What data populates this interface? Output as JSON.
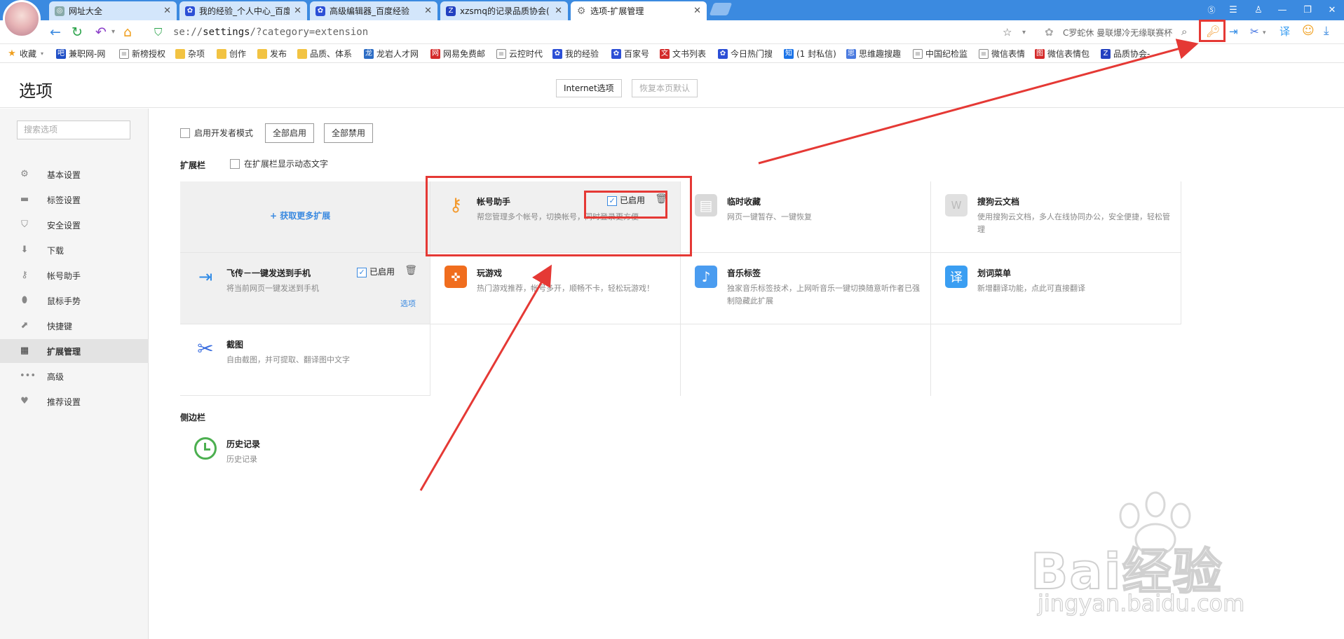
{
  "tabs": [
    {
      "label": "网址大全",
      "active": false,
      "icon": "globe-icon"
    },
    {
      "label": "我的经验_个人中心_百度",
      "active": false,
      "icon": "baidu-paw-icon"
    },
    {
      "label": "高级编辑器_百度经验",
      "active": false,
      "icon": "baidu-paw-icon"
    },
    {
      "label": "xzsmq的记录品质协会(",
      "active": false,
      "icon": "baidu-z-icon"
    },
    {
      "label": "选项-扩展管理",
      "active": true,
      "icon": "gear-icon"
    }
  ],
  "address": {
    "prefix": "se://",
    "bold": "settings",
    "suffix": "/?category=extension"
  },
  "search_box": "C罗蛇休 曼联爆冷无缘联赛杯",
  "bookmarks": [
    "收藏",
    "兼职网-网",
    "新榜授权",
    "杂项",
    "创作",
    "发布",
    "品质、体系",
    "龙岩人才网",
    "网易免费邮",
    "云控时代",
    "我的经验",
    "百家号",
    "文书列表",
    "今日热门搜",
    "(1 封私信)",
    "思维趣搜趣",
    "中国纪检监",
    "微信表情",
    "微信表情包",
    "品质协会-"
  ],
  "page": {
    "title": "选项",
    "internet_options": "Internet选项",
    "restore_defaults": "恢复本页默认"
  },
  "sidebar": {
    "search_placeholder": "搜索选项",
    "items": [
      {
        "label": "基本设置",
        "icon": "gear-icon"
      },
      {
        "label": "标签设置",
        "icon": "tab-icon"
      },
      {
        "label": "安全设置",
        "icon": "shield-icon"
      },
      {
        "label": "下载",
        "icon": "download-icon"
      },
      {
        "label": "帐号助手",
        "icon": "key-icon"
      },
      {
        "label": "鼠标手势",
        "icon": "mouse-icon"
      },
      {
        "label": "快捷键",
        "icon": "shortcut-icon"
      },
      {
        "label": "扩展管理",
        "icon": "grid-icon",
        "selected": true
      },
      {
        "label": "高级",
        "icon": "more-icon"
      },
      {
        "label": "推荐设置",
        "icon": "heart-icon"
      }
    ]
  },
  "main": {
    "dev_mode": "启用开发者模式",
    "enable_all": "全部启用",
    "disable_all": "全部禁用",
    "extbar_title": "扩展栏",
    "show_dynamic": "在扩展栏显示动态文字",
    "get_more": "+ 获取更多扩展",
    "sidebar_title": "侧边栏",
    "enabled_label": "已启用",
    "options_label": "选项",
    "extensions": [
      {
        "name": "帐号助手",
        "desc": "帮您管理多个帐号，切换帐号，同时登录更方便",
        "icon": "key-icon",
        "color": "#f39a2e",
        "enabled": true,
        "gray": true
      },
      {
        "name": "临时收藏",
        "desc": "网页一键暂存、一键恢复",
        "icon": "bookmark-icon",
        "color": "#cfcfcf"
      },
      {
        "name": "搜狗云文档",
        "desc": "使用搜狗云文档，多人在线协同办公，安全便捷，轻松管理",
        "icon": "doc-icon",
        "color": "#d6d6d6"
      },
      {
        "name": "飞传－一键发送到手机",
        "desc": "将当前网页一键发送到手机",
        "icon": "send-phone-icon",
        "color": "#2e8ae6",
        "enabled": true,
        "gray": true,
        "options": true
      },
      {
        "name": "玩游戏",
        "desc": "热门游戏推荐，帐号多开，顺畅不卡，轻松玩游戏！",
        "icon": "gamepad-icon",
        "color": "#f06d1e"
      },
      {
        "name": "音乐标签",
        "desc": "独家音乐标签技术，上网听音乐一键切换随意听作者已强制隐藏此扩展",
        "icon": "music-icon",
        "color": "#4a9cf0"
      },
      {
        "name": "划词菜单",
        "desc": "新增翻译功能，点此可直接翻译",
        "icon": "translate-icon",
        "color": "#3a9ef2"
      },
      {
        "name": "截图",
        "desc": "自由截图，并可提取、翻译图中文字",
        "icon": "scissors-icon",
        "color": "#3b6ee0"
      }
    ],
    "sidebar_ext": {
      "name": "历史记录",
      "desc": "历史记录",
      "icon": "clock-icon"
    }
  },
  "watermark": {
    "brand": "Bai经验",
    "url": "jingyan.baidu.com"
  }
}
